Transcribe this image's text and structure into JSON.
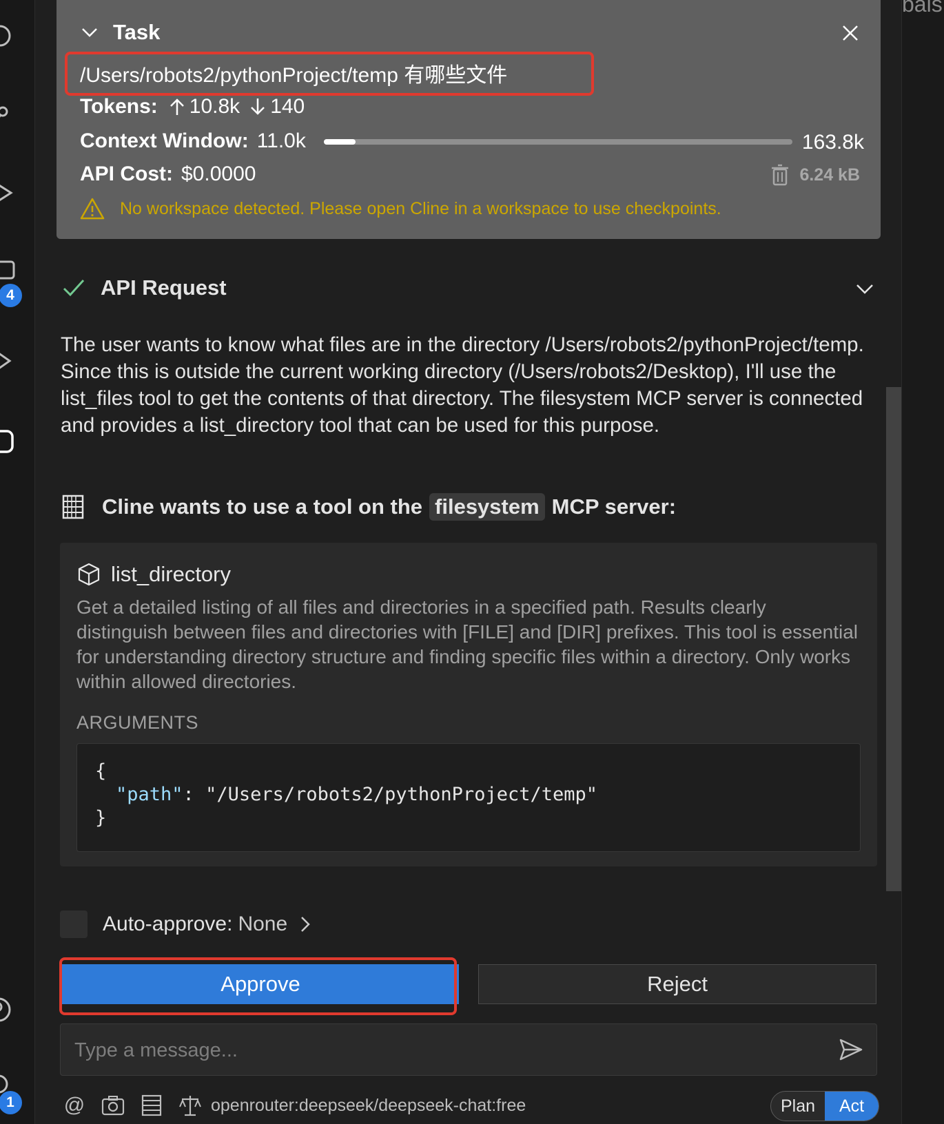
{
  "right_panel": {
    "clipped_text": "bals"
  },
  "activity_bar": {
    "badge_top": "4",
    "badge_bottom": "1"
  },
  "task": {
    "title": "Task",
    "text": "/Users/robots2/pythonProject/temp  有哪些文件",
    "tokens_label": "Tokens:",
    "tokens_in": "10.8k",
    "tokens_out": "140",
    "context_label": "Context Window:",
    "context_used": "11.0k",
    "context_max": "163.8k",
    "context_fraction": 0.067,
    "cost_label": "API Cost:",
    "cost_value": "$0.0000",
    "size": "6.24 kB",
    "warning": "No workspace detected. Please open Cline in a workspace to use checkpoints."
  },
  "api_request": {
    "title": "API Request"
  },
  "reasoning": "The user wants to know what files are in the directory /Users/robots2/pythonProject/temp. Since this is outside the current working directory (/Users/robots2/Desktop), I'll use the list_files tool to get the contents of that directory. The filesystem MCP server is connected and provides a list_directory tool that can be used for this purpose.",
  "mcp": {
    "prefix": "Cline wants to use a tool on the",
    "server": "filesystem",
    "suffix": "MCP server:"
  },
  "tool": {
    "name": "list_directory",
    "description": "Get a detailed listing of all files and directories in a specified path. Results clearly distinguish between files and directories with [FILE] and [DIR] prefixes. This tool is essential for understanding directory structure and finding specific files within a directory. Only works within allowed directories.",
    "args_label": "ARGUMENTS",
    "code_open": "{",
    "code_key": "\"path\"",
    "code_sep": ": ",
    "code_value": "\"/Users/robots2/pythonProject/temp\"",
    "code_close": "}"
  },
  "auto_approve": {
    "label": "Auto-approve:",
    "value": "None"
  },
  "buttons": {
    "approve": "Approve",
    "reject": "Reject"
  },
  "message": {
    "placeholder": "Type a message..."
  },
  "bottom": {
    "model": "openrouter:deepseek/deepseek-chat:free",
    "mode_plan": "Plan",
    "mode_act": "Act"
  }
}
